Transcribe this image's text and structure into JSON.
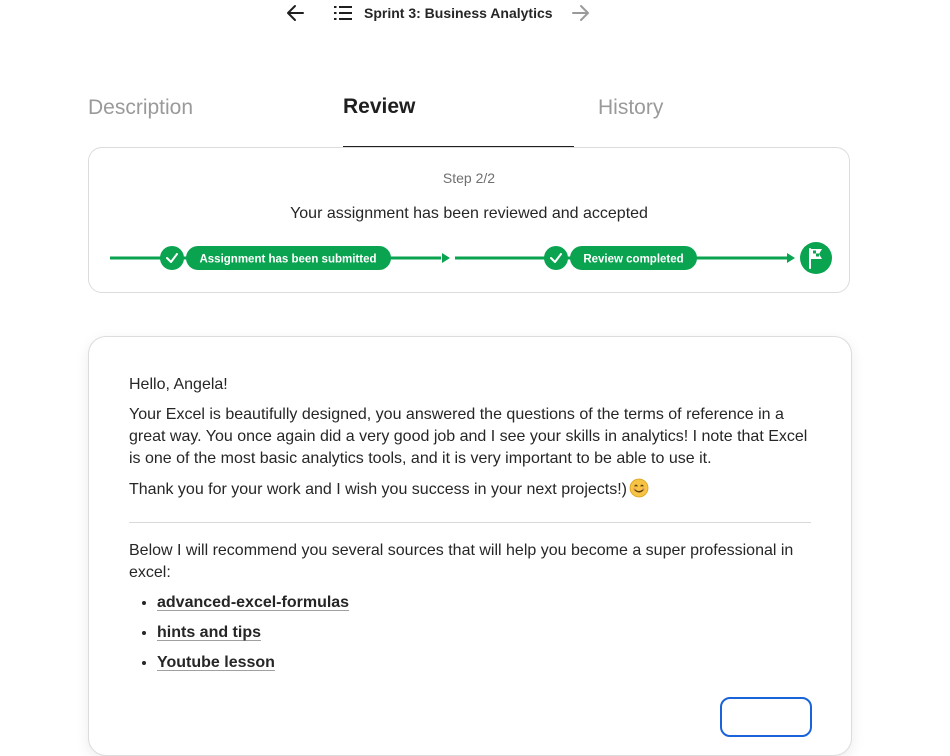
{
  "nav": {
    "title": "Sprint 3: Business Analytics",
    "back_icon": "arrow-left-icon",
    "forward_icon": "arrow-right-icon",
    "list_icon": "list-icon"
  },
  "tabs": [
    {
      "label": "Description",
      "active": false
    },
    {
      "label": "Review",
      "active": true
    },
    {
      "label": "History",
      "active": false
    }
  ],
  "status": {
    "step_label": "Step 2/2",
    "message": "Your assignment has been reviewed and accepted",
    "steps": [
      {
        "label": "Assignment has been submitted",
        "done": true
      },
      {
        "label": "Review completed",
        "done": true
      }
    ],
    "finish_icon": "finish-flag-icon",
    "accent_color": "#0aa350"
  },
  "review": {
    "greeting": "Hello, Angela!",
    "paragraph1": "Your Excel is beautifully designed, you answered the questions of the terms of reference in a great way. You once again did a very good job and I see your skills in analytics! I note that Excel is one of the most basic analytics tools, and it is very important to be able to use it.",
    "paragraph2": "Thank you for your work and I wish you success in your next projects!)",
    "emoji_icon": "smiling-face-icon",
    "recommend_intro": "Below I will recommend you several sources that will help you become a super professional in excel:",
    "links": [
      {
        "label": "advanced-excel-formulas"
      },
      {
        "label": "hints and tips"
      },
      {
        "label": "Youtube lesson"
      }
    ],
    "button_color": "#1a63d9"
  }
}
